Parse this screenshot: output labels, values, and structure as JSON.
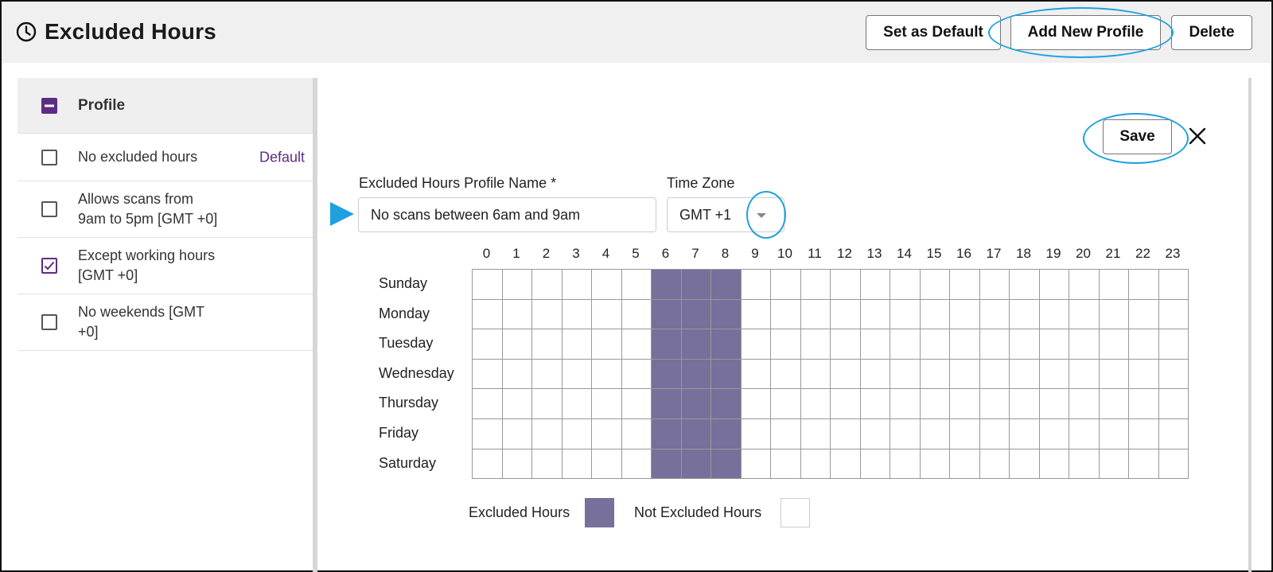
{
  "header": {
    "title": "Excluded Hours",
    "buttons": {
      "set_default": "Set as Default",
      "add_new": "Add New Profile",
      "delete": "Delete"
    }
  },
  "sidebar": {
    "column_header": "Profile",
    "items": [
      {
        "label_line1": "No excluded hours",
        "label_line2": "",
        "checked": false,
        "badge": "Default"
      },
      {
        "label_line1": "Allows scans from",
        "label_line2": "9am to 5pm [GMT +0]",
        "checked": false,
        "badge": ""
      },
      {
        "label_line1": "Except working hours",
        "label_line2": "[GMT +0]",
        "checked": true,
        "badge": ""
      },
      {
        "label_line1": "No weekends [GMT",
        "label_line2": "+0]",
        "checked": false,
        "badge": ""
      }
    ]
  },
  "form": {
    "save_label": "Save",
    "name_label": "Excluded Hours Profile Name *",
    "name_value": "No scans between 6am and 9am",
    "tz_label": "Time Zone",
    "tz_value": "GMT +1"
  },
  "schedule": {
    "hours": [
      "0",
      "1",
      "2",
      "3",
      "4",
      "5",
      "6",
      "7",
      "8",
      "9",
      "10",
      "11",
      "12",
      "13",
      "14",
      "15",
      "16",
      "17",
      "18",
      "19",
      "20",
      "21",
      "22",
      "23"
    ],
    "days": [
      "Sunday",
      "Monday",
      "Tuesday",
      "Wednesday",
      "Thursday",
      "Friday",
      "Saturday"
    ],
    "excluded_hours": [
      6,
      7,
      8
    ]
  },
  "legend": {
    "excluded": "Excluded Hours",
    "not_excluded": "Not Excluded Hours"
  },
  "colors": {
    "accent": "#5c2d82",
    "excluded_fill": "#76709a",
    "highlight": "#1fa0e0"
  },
  "icons": {
    "title": "clock-icon",
    "close": "close-icon",
    "tz": "chevron-down-icon",
    "pointer": "pointer-arrow-icon"
  }
}
